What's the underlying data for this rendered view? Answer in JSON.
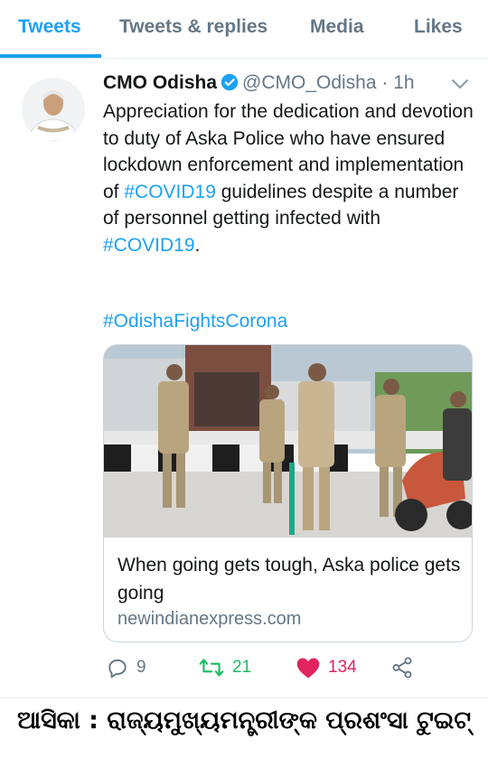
{
  "tabs": [
    {
      "label": "Tweets",
      "active": true
    },
    {
      "label": "Tweets & replies",
      "active": false
    },
    {
      "label": "Media",
      "active": false
    },
    {
      "label": "Likes",
      "active": false
    }
  ],
  "tweet": {
    "author_name": "CMO Odisha",
    "handle": "@CMO_Odisha",
    "time": "· 1h",
    "verified": true,
    "text_part1": "Appreciation for the dedication and devotion to duty of Aska Police who have ensured lockdown enforcement and implementation of ",
    "hashtag1": "#COVID19",
    "text_part2": " guidelines despite a number of personnel getting infected with ",
    "hashtag2": "#COVID19",
    "text_part3": ".",
    "hashtag3": "#OdishaFightsCorona",
    "card": {
      "title": "When going gets tough, Aska police gets going",
      "domain": "newindianexpress.com"
    },
    "actions": {
      "replies": "9",
      "retweets": "21",
      "likes": "134"
    }
  },
  "colors": {
    "accent": "#1da1f2",
    "muted": "#657786",
    "retweet": "#17bf63",
    "like": "#e0245e"
  },
  "icons": [
    "verified-badge-icon",
    "chevron-down-icon",
    "reply-icon",
    "retweet-icon",
    "heart-icon",
    "share-icon"
  ],
  "caption": "ଆସିକା : ରାଜ୍ୟମୁଖ୍ୟମନ୍ତ୍ରୀଙ୍କ ପ୍ରଶଂସା ଟୁଇଟ୍"
}
